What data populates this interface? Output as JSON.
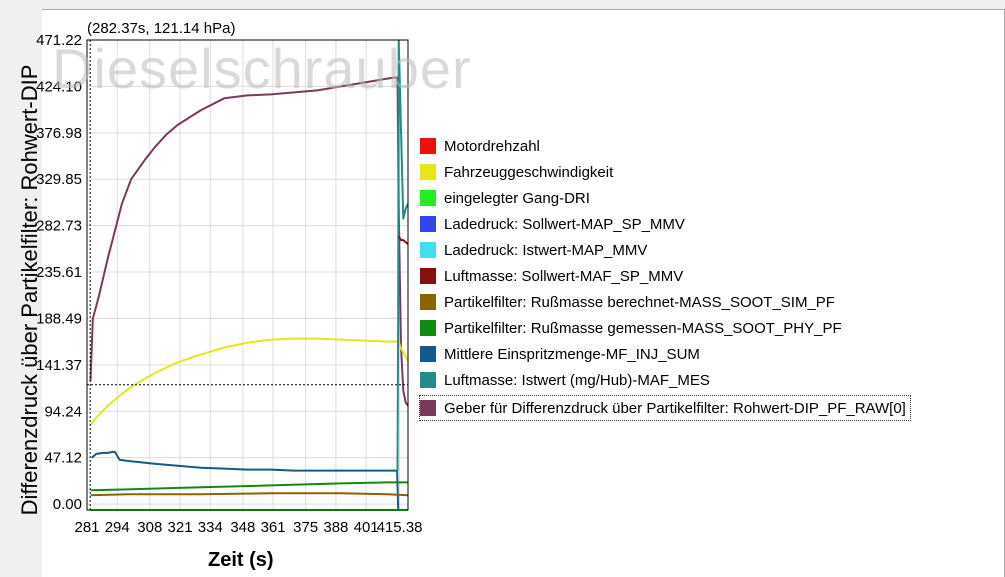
{
  "watermark": "Dieselschrauber",
  "cursor_readout": "(282.37s, 121.14 hPa)",
  "legend": {
    "items": [
      {
        "label": "Motordrehzahl",
        "color": "#ee1111"
      },
      {
        "label": "Fahrzeuggeschwindigkeit",
        "color": "#e6e619"
      },
      {
        "label": "eingelegter Gang-DRI",
        "color": "#22ee22"
      },
      {
        "label": "Ladedruck: Sollwert-MAP_SP_MMV",
        "color": "#3344ee"
      },
      {
        "label": "Ladedruck: Istwert-MAP_MMV",
        "color": "#44ddf0"
      },
      {
        "label": "Luftmasse: Sollwert-MAF_SP_MMV",
        "color": "#8a1010"
      },
      {
        "label": "Partikelfilter: Rußmasse berechnet-MASS_SOOT_SIM_PF",
        "color": "#8a6400"
      },
      {
        "label": "Partikelfilter: Rußmasse gemessen-MASS_SOOT_PHY_PF",
        "color": "#118a11"
      },
      {
        "label": "Mittlere Einspritzmenge-MF_INJ_SUM",
        "color": "#155a8a"
      },
      {
        "label": "Luftmasse: Istwert (mg/Hub)-MAF_MES",
        "color": "#248a8a"
      },
      {
        "label": "Geber für Differenzdruck über Partikelfilter: Rohwert-DIP_PF_RAW[0]",
        "color": "#7a3a5e",
        "selected": true
      }
    ]
  },
  "chart_data": {
    "type": "line",
    "xlabel": "Zeit (s)",
    "ylabel": "Differenzdruck über Partikelfilter: Rohwert-DIP",
    "xlim": [
      281,
      419
    ],
    "ylim": [
      -6,
      471.22
    ],
    "x_ticks": [
      "281",
      "294",
      "308",
      "321",
      "334",
      "348",
      "361",
      "375",
      "388",
      "401",
      "415.38"
    ],
    "x_tick_values": [
      281,
      294,
      308,
      321,
      334,
      348,
      361,
      375,
      388,
      401,
      415.38
    ],
    "y_ticks": [
      "0.00",
      "47.12",
      "94.24",
      "141.37",
      "188.49",
      "235.61",
      "282.73",
      "329.85",
      "376.98",
      "424.10",
      "471.22"
    ],
    "y_tick_values": [
      0,
      47.12,
      94.24,
      141.37,
      188.49,
      235.61,
      282.73,
      329.85,
      376.98,
      424.1,
      471.22
    ],
    "grid": true,
    "cursor": {
      "x": 282.37,
      "y": 121.14
    },
    "series": [
      {
        "name": "Geber für Differenzdruck über Partikelfilter: Rohwert-DIP_PF_RAW[0]",
        "color": "#7a3a5e",
        "x": [
          282.5,
          283.5,
          286,
          290,
          296,
          300,
          306,
          310,
          315,
          320,
          330,
          340,
          350,
          360,
          370,
          380,
          390,
          400,
          405,
          410,
          413,
          414.5,
          415,
          416,
          417,
          418,
          419
        ],
        "y": [
          125,
          188,
          210,
          250,
          305,
          330,
          350,
          362,
          375,
          385,
          400,
          412,
          415,
          416,
          418,
          420,
          424,
          428,
          430,
          432,
          433,
          433,
          300,
          160,
          115,
          103,
          100
        ]
      },
      {
        "name": "Fahrzeuggeschwindigkeit",
        "color": "#e6e619",
        "x": [
          282.5,
          285,
          290,
          295,
          300,
          305,
          310,
          320,
          330,
          340,
          350,
          360,
          370,
          380,
          390,
          400,
          410,
          415,
          416,
          418,
          419
        ],
        "y": [
          80,
          88,
          100,
          110,
          119,
          126,
          133,
          144,
          152,
          159,
          164,
          167,
          168,
          168,
          167,
          166,
          165,
          165,
          158,
          150,
          145
        ]
      },
      {
        "name": "Mittlere Einspritzmenge-MF_INJ_SUM",
        "color": "#155a8a",
        "x": [
          283,
          285,
          288,
          290,
          292,
          293,
          295,
          298,
          302,
          310,
          320,
          330,
          340,
          350,
          360,
          370,
          380,
          390,
          400,
          410,
          413,
          414.3,
          414.8,
          419
        ],
        "y": [
          47,
          51,
          52,
          52,
          53,
          53,
          45,
          44,
          43,
          41,
          39,
          37,
          36,
          35,
          35,
          34,
          34,
          34,
          34,
          34,
          34,
          34,
          -6,
          -6
        ]
      },
      {
        "name": "Luftmasse: Istwert (mg/Hub)-MAF_MES",
        "color": "#248a8a",
        "x": [
          414.5,
          414.8,
          415,
          417,
          418,
          419
        ],
        "y": [
          34,
          200,
          471,
          290,
          300,
          305
        ]
      },
      {
        "name": "Luftmasse: Sollwert-MAF_SP_MMV",
        "color": "#8a1010",
        "x": [
          415,
          416,
          417,
          418,
          419
        ],
        "y": [
          272,
          268,
          268,
          266,
          264
        ]
      },
      {
        "name": "Partikelfilter: Rußmasse gemessen-MASS_SOOT_PHY_PF",
        "color": "#118a11",
        "x": [
          282.5,
          300,
          330,
          360,
          390,
          410,
          419
        ],
        "y": [
          14,
          15,
          17,
          19,
          21,
          22,
          22
        ]
      },
      {
        "name": "Partikelfilter: Rußmasse berechnet-MASS_SOOT_SIM_PF",
        "color": "#8a6400",
        "x": [
          282.5,
          300,
          330,
          360,
          390,
          410,
          419
        ],
        "y": [
          9,
          10,
          10,
          11,
          11,
          10,
          9
        ]
      },
      {
        "name": "eingelegter Gang-DRI",
        "color": "#22ee22",
        "x": [
          282.5,
          419
        ],
        "y": [
          -6,
          -6
        ]
      }
    ]
  }
}
